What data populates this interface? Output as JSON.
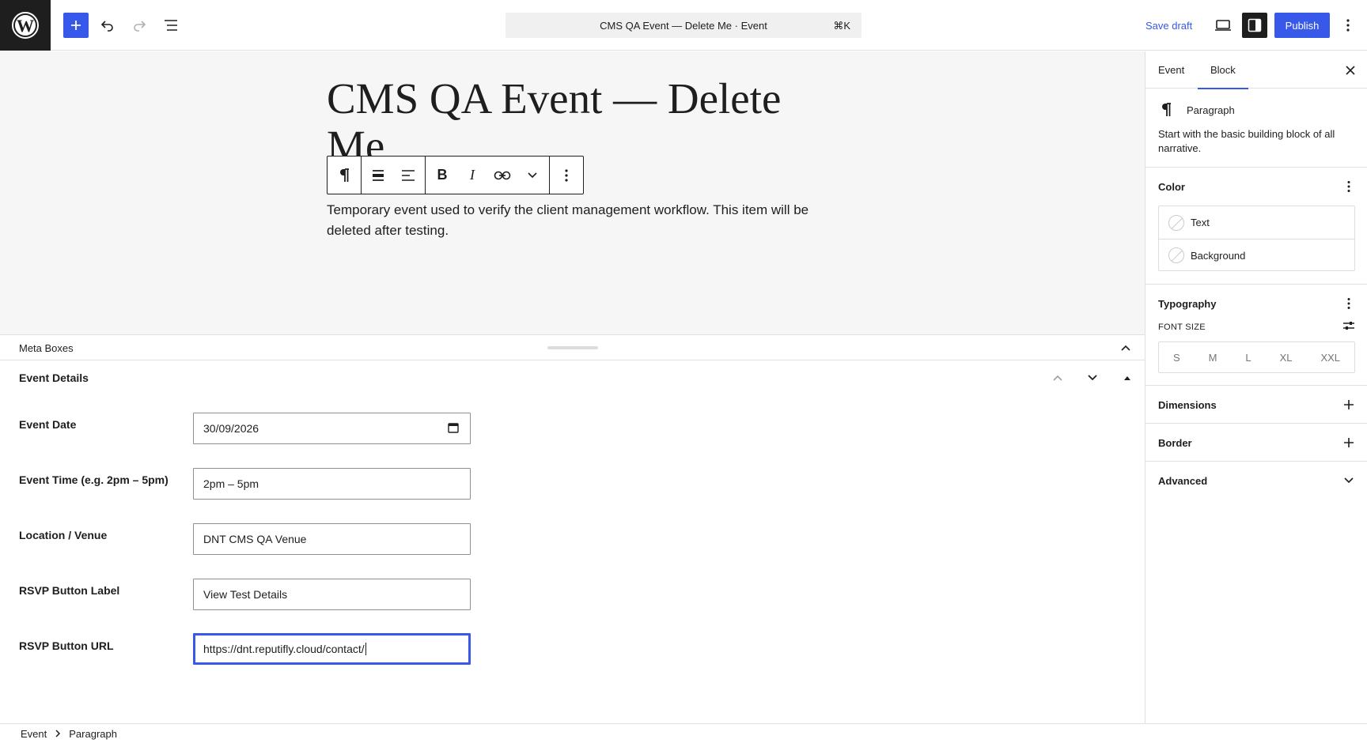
{
  "topbar": {
    "document_title": "CMS QA Event — Delete Me · Event",
    "shortcut": "⌘K",
    "save_draft": "Save draft",
    "publish": "Publish"
  },
  "editor": {
    "post_title": "CMS QA Event — Delete Me",
    "paragraph": "Temporary event used to verify the client management workflow. This item will be deleted after testing."
  },
  "meta_boxes": {
    "header": "Meta Boxes",
    "panel_title": "Event Details",
    "fields": [
      {
        "label": "Event Date",
        "value": "30/09/2026"
      },
      {
        "label": "Event Time (e.g. 2pm – 5pm)",
        "value": "2pm – 5pm"
      },
      {
        "label": "Location / Venue",
        "value": "DNT CMS QA Venue"
      },
      {
        "label": "RSVP Button Label",
        "value": "View Test Details"
      },
      {
        "label": "RSVP Button URL",
        "value": "https://dnt.reputifly.cloud/contact/"
      }
    ]
  },
  "breadcrumb": {
    "items": [
      "Event",
      "Paragraph"
    ]
  },
  "sidebar": {
    "tabs": [
      "Event",
      "Block"
    ],
    "active_tab": "Block",
    "block_name": "Paragraph",
    "block_description": "Start with the basic building block of all narrative.",
    "color": {
      "title": "Color",
      "items": [
        "Text",
        "Background"
      ]
    },
    "typography": {
      "title": "Typography",
      "font_size_label": "FONT SIZE",
      "sizes": [
        "S",
        "M",
        "L",
        "XL",
        "XXL"
      ]
    },
    "dimensions": "Dimensions",
    "border": "Border",
    "advanced": "Advanced"
  },
  "colors": {
    "accent": "#3858e9",
    "dark": "#1e1e1e",
    "canvas_bg": "#f6f6f6"
  }
}
